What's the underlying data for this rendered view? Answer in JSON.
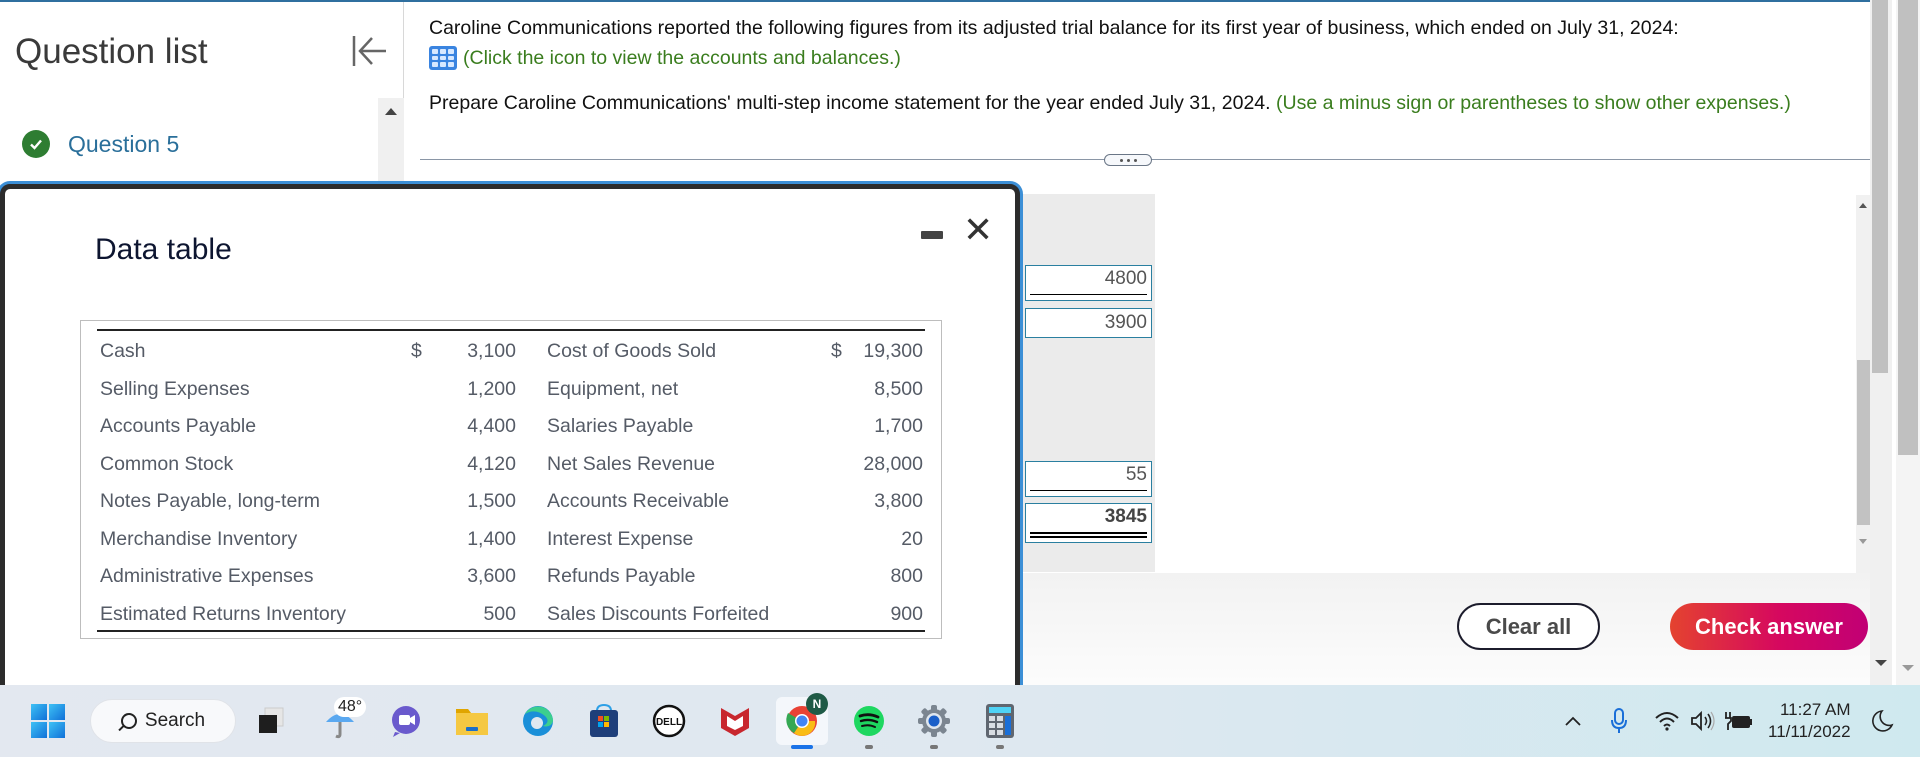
{
  "sidebar": {
    "title": "Question list",
    "collapse_icon": "collapse-left-icon",
    "items": [
      {
        "label": "Question 5",
        "status": "completed",
        "status_icon": "check-circle-icon"
      }
    ]
  },
  "question": {
    "intro": "Caroline Communications reported the following figures from its adjusted trial balance for its first year of business, which ended on July 31, 2024:",
    "icon_hint": "(Click the icon to view the accounts and balances.)",
    "instruction": "Prepare Caroline Communications' multi-step income statement for the year ended July 31, 2024.",
    "instruction_hint": "(Use a minus sign or parentheses to show other expenses.)",
    "more_button_icon": "ellipsis-icon"
  },
  "answer_inputs": [
    {
      "value": "4800",
      "underline": "single"
    },
    {
      "value": "3900",
      "underline": "none"
    },
    {
      "value": "55",
      "underline": "single"
    },
    {
      "value": "3845",
      "underline": "double",
      "bold": true
    }
  ],
  "buttons": {
    "clear_all": "Clear all",
    "check_answer": "Check answer"
  },
  "modal": {
    "title": "Data table",
    "minimize_icon": "minimize-icon",
    "close_icon": "close-icon",
    "close_glyph": "✕",
    "currency_symbol": "$",
    "left_column": [
      {
        "account": "Cash",
        "currency": "$",
        "amount": "3,100"
      },
      {
        "account": "Selling Expenses",
        "currency": "",
        "amount": "1,200"
      },
      {
        "account": "Accounts Payable",
        "currency": "",
        "amount": "4,400"
      },
      {
        "account": "Common Stock",
        "currency": "",
        "amount": "4,120"
      },
      {
        "account": "Notes Payable, long-term",
        "currency": "",
        "amount": "1,500"
      },
      {
        "account": "Merchandise Inventory",
        "currency": "",
        "amount": "1,400"
      },
      {
        "account": "Administrative Expenses",
        "currency": "",
        "amount": "3,600"
      },
      {
        "account": "Estimated Returns Inventory",
        "currency": "",
        "amount": "500"
      }
    ],
    "right_column": [
      {
        "account": "Cost of Goods Sold",
        "currency": "$",
        "amount": "19,300"
      },
      {
        "account": "Equipment, net",
        "currency": "",
        "amount": "8,500"
      },
      {
        "account": "Salaries Payable",
        "currency": "",
        "amount": "1,700"
      },
      {
        "account": "Net Sales Revenue",
        "currency": "",
        "amount": "28,000"
      },
      {
        "account": "Accounts Receivable",
        "currency": "",
        "amount": "3,800"
      },
      {
        "account": "Interest Expense",
        "currency": "",
        "amount": "20"
      },
      {
        "account": "Refunds Payable",
        "currency": "",
        "amount": "800"
      },
      {
        "account": "Sales Discounts Forfeited",
        "currency": "",
        "amount": "900"
      }
    ]
  },
  "taskbar": {
    "search_label": "Search",
    "weather_temp": "48°",
    "apps": [
      {
        "name": "start",
        "icon": "windows-logo-icon"
      },
      {
        "name": "task-view",
        "icon": "task-view-icon"
      },
      {
        "name": "weather",
        "icon": "umbrella-icon"
      },
      {
        "name": "teams-chat",
        "icon": "video-chat-icon"
      },
      {
        "name": "file-explorer",
        "icon": "folder-icon"
      },
      {
        "name": "edge",
        "icon": "edge-browser-icon"
      },
      {
        "name": "microsoft-store",
        "icon": "store-icon"
      },
      {
        "name": "dell",
        "icon": "dell-logo-icon"
      },
      {
        "name": "mcafee",
        "icon": "mcafee-icon"
      },
      {
        "name": "chrome",
        "icon": "chrome-icon",
        "badge": "N",
        "active": true
      },
      {
        "name": "spotify",
        "icon": "spotify-icon"
      },
      {
        "name": "settings",
        "icon": "settings-gear-icon"
      },
      {
        "name": "calculator",
        "icon": "calculator-icon"
      }
    ],
    "tray": {
      "chevron": "^",
      "icons": [
        "microphone-icon",
        "wifi-icon",
        "volume-icon",
        "battery-charging-icon",
        "focus-moon-icon"
      ],
      "time": "11:27 AM",
      "date": "11/11/2022"
    }
  },
  "colors": {
    "accent_blue": "#2a6f9a",
    "hint_green": "#3a7d1e",
    "check_answer_gradient_start": "#e4432f",
    "check_answer_gradient_end": "#c10075",
    "completed_green": "#2e7d32"
  }
}
